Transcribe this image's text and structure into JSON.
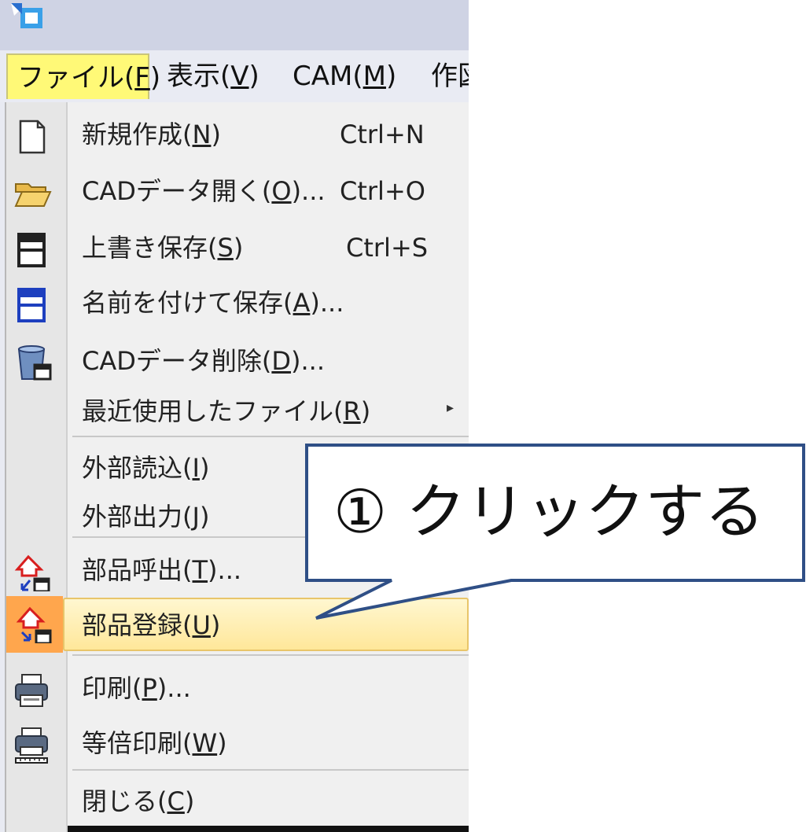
{
  "menubar": {
    "items": [
      {
        "label": "ファイル(",
        "mnemonic": "F",
        "suffix": ")"
      },
      {
        "label": "表示(",
        "mnemonic": "V",
        "suffix": ")"
      },
      {
        "label": "CAM(",
        "mnemonic": "M",
        "suffix": ")"
      },
      {
        "label": "作図"
      }
    ]
  },
  "file_menu": {
    "items": [
      {
        "label": "新規作成(",
        "mnemonic": "N",
        "suffix": ")",
        "shortcut": "Ctrl+N",
        "icon": "new-document-icon"
      },
      {
        "label": "CADデータ開く(",
        "mnemonic": "O",
        "suffix": ")...",
        "shortcut": "Ctrl+O",
        "icon": "folder-open-icon"
      },
      {
        "label": "上書き保存(",
        "mnemonic": "S",
        "suffix": ")",
        "shortcut": "Ctrl+S",
        "icon": "save-icon"
      },
      {
        "label": "名前を付けて保存(",
        "mnemonic": "A",
        "suffix": ")...",
        "icon": "save-as-icon"
      },
      {
        "label": "CADデータ削除(",
        "mnemonic": "D",
        "suffix": ")...",
        "icon": "delete-data-icon"
      },
      {
        "label": "最近使用したファイル(",
        "mnemonic": "R",
        "suffix": ")",
        "icon": "",
        "submenu_arrow": "▸"
      },
      {
        "label": "外部読込(",
        "mnemonic": "I",
        "suffix": ")"
      },
      {
        "label": "外部出力(",
        "mnemonic": "J",
        "suffix": ")"
      },
      {
        "label": "部品呼出(",
        "mnemonic": "T",
        "suffix": ")...",
        "icon": "part-call-icon"
      },
      {
        "label": "部品登録(",
        "mnemonic": "U",
        "suffix": ")",
        "icon": "part-register-icon",
        "highlighted": true
      },
      {
        "label": "印刷(",
        "mnemonic": "P",
        "suffix": ")...",
        "icon": "print-icon"
      },
      {
        "label": "等倍印刷(",
        "mnemonic": "W",
        "suffix": ")",
        "icon": "actual-size-print-icon"
      },
      {
        "label": "閉じる(",
        "mnemonic": "C",
        "suffix": ")"
      }
    ]
  },
  "callout": {
    "text": "① クリックする",
    "border_color": "#2f4f86"
  },
  "colors": {
    "highlight_top": "#fff977",
    "hover_item": "#ffe79a",
    "hover_icon": "#ffa64d",
    "icon_red": "#d81e1e",
    "icon_blue": "#1d3fbf"
  }
}
